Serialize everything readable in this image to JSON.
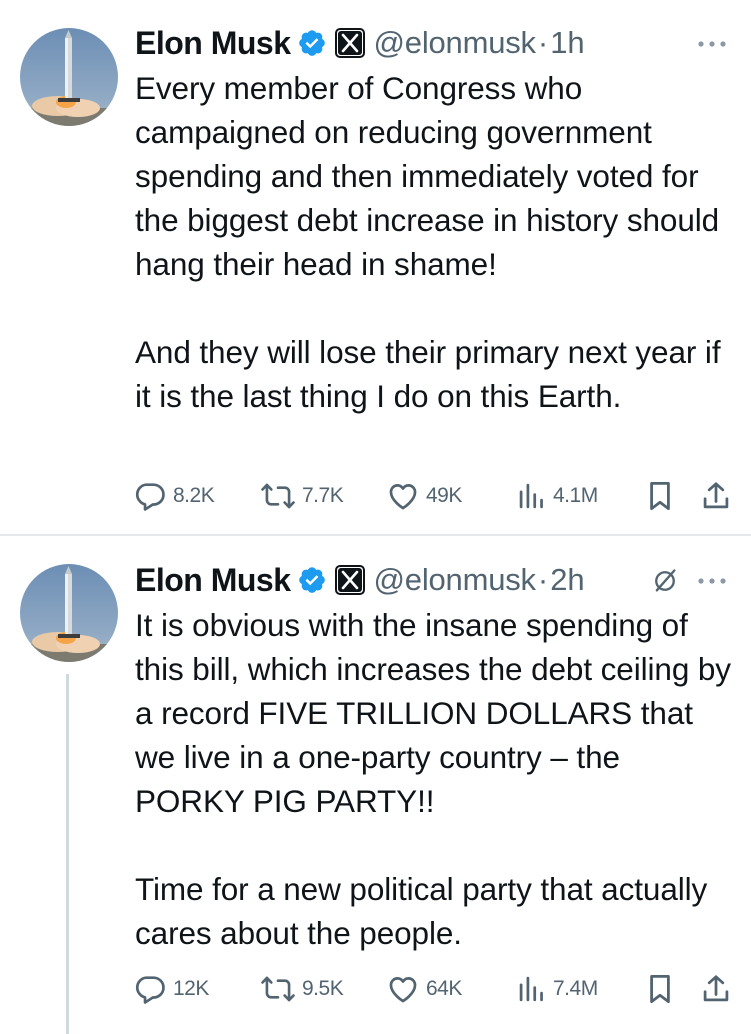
{
  "tweets": [
    {
      "author_name": "Elon Musk",
      "handle": "@elonmusk",
      "separator": "·",
      "time": "1h",
      "text": "Every member of Congress who campaigned on reducing government spending and then immediately voted for the biggest debt increase in history should hang their head in shame!\n\nAnd they will lose their primary next year if it is the last thing I do on this Earth.",
      "replies": "8.2K",
      "reposts": "7.7K",
      "likes": "49K",
      "views": "4.1M"
    },
    {
      "author_name": "Elon Musk",
      "handle": "@elonmusk",
      "separator": "·",
      "time": "2h",
      "text": "It is obvious with the insane spending of this bill, which increases the debt ceiling by a record FIVE TRILLION DOLLARS that we live in a one-party country – the PORKY PIG PARTY!!\n\nTime for a new political party that actually cares about the people.",
      "replies": "12K",
      "reposts": "9.5K",
      "likes": "64K",
      "views": "7.4M"
    }
  ],
  "icons": {
    "verified": "verified-badge-icon",
    "affiliate": "x-logo-icon",
    "grok": "grok-icon",
    "more": "more-icon",
    "reply": "reply-icon",
    "repost": "repost-icon",
    "like": "like-icon",
    "views": "views-icon",
    "bookmark": "bookmark-icon",
    "share": "share-icon"
  },
  "colors": {
    "verified_blue": "#1d9bf0",
    "text_primary": "#0f1419",
    "text_secondary": "#536471",
    "divider": "#e6e9ec",
    "thread_line": "#cfd9de"
  }
}
